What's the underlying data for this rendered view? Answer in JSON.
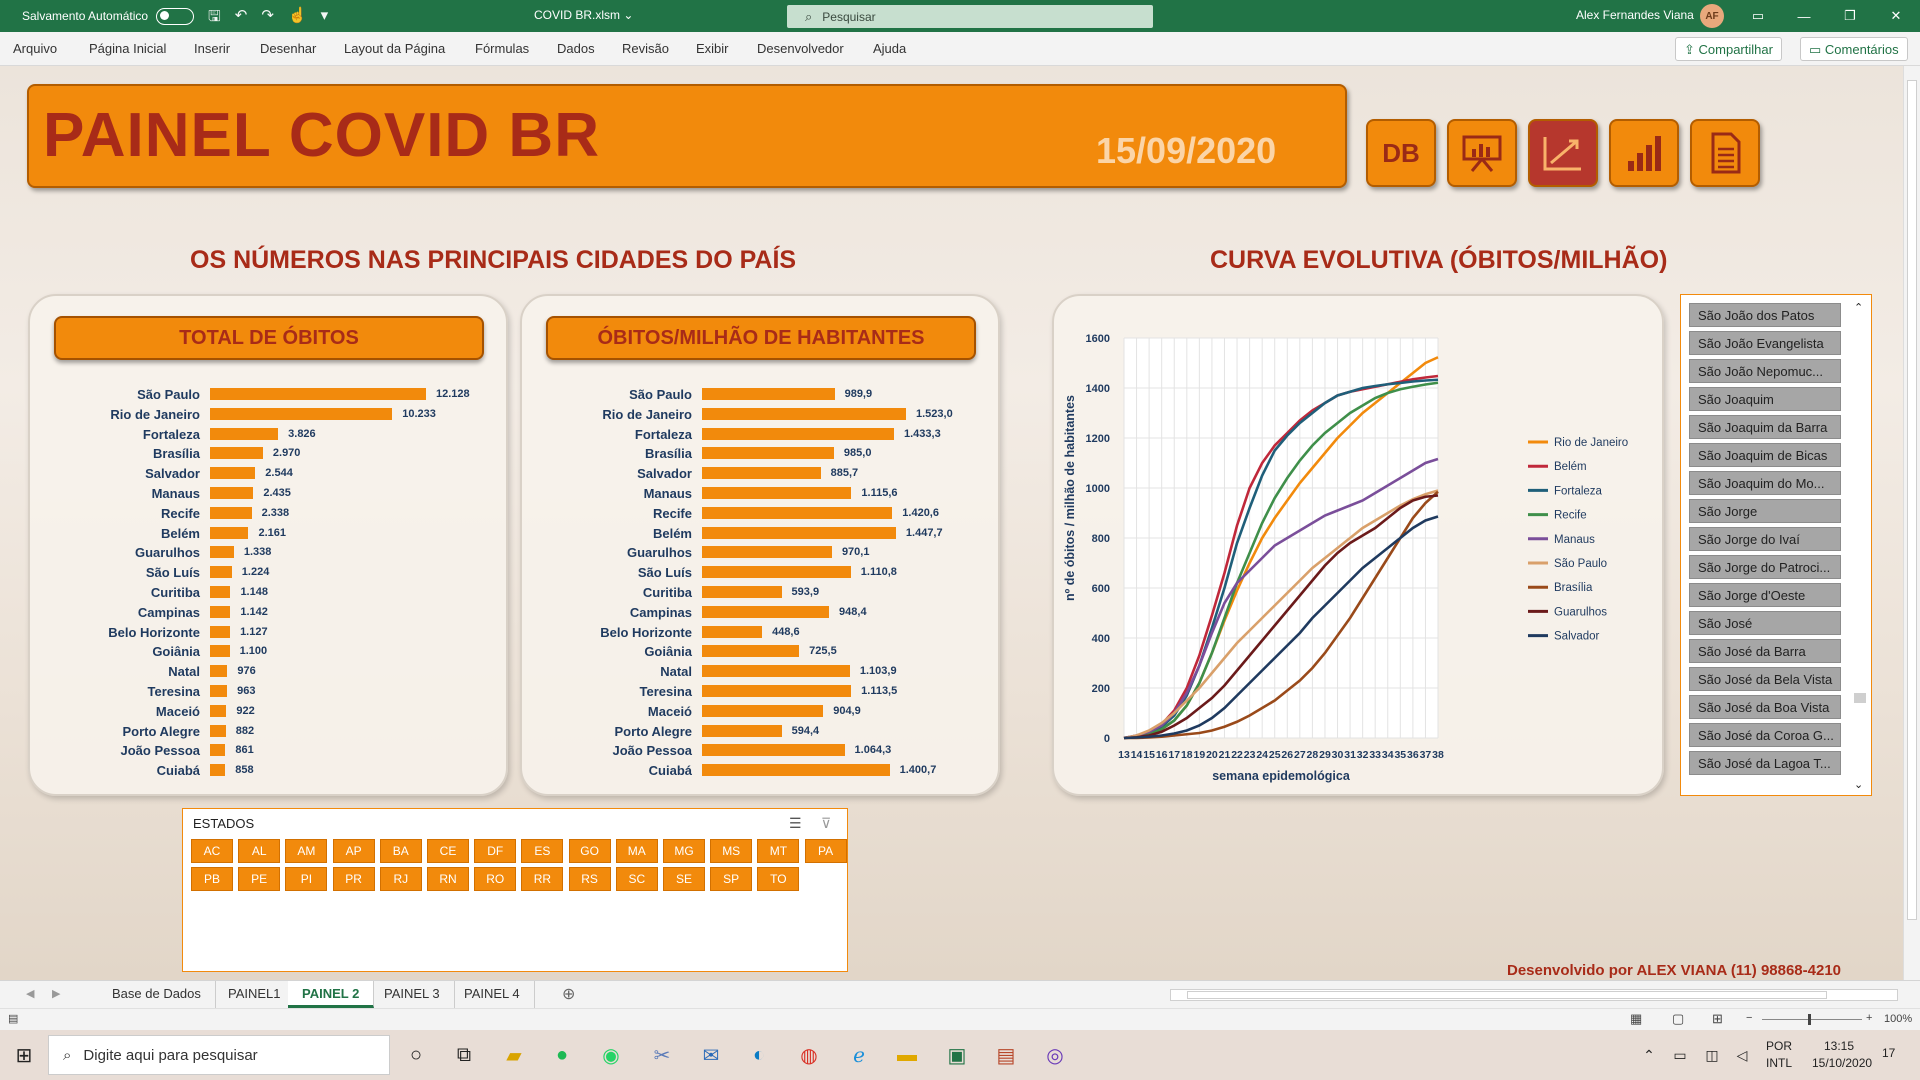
{
  "titlebar": {
    "autosave_label": "Salvamento Automático",
    "doc_title": "COVID BR.xlsm",
    "doc_caret": "⌄",
    "search_placeholder": "Pesquisar",
    "user_name": "Alex Fernandes Viana",
    "user_initials": "AF"
  },
  "menu": {
    "items": [
      "Arquivo",
      "Página Inicial",
      "Inserir",
      "Desenhar",
      "Layout da Página",
      "Fórmulas",
      "Dados",
      "Revisão",
      "Exibir",
      "Desenvolvedor",
      "Ajuda"
    ],
    "share": "Compartilhar",
    "comments": "Comentários"
  },
  "banner": {
    "title": "PAINEL COVID BR",
    "date": "15/09/2020",
    "nav_db": "DB"
  },
  "sections": {
    "left_title": "OS NÚMEROS NAS PRINCIPAIS CIDADES DO PAÍS",
    "right_title": "CURVA EVOLUTIVA (ÓBITOS/MILHÃO)"
  },
  "panels": {
    "total_title": "TOTAL DE ÓBITOS",
    "per_million_title": "ÓBITOS/MILHÃO DE HABITANTES"
  },
  "cities": [
    "São Paulo",
    "Rio de Janeiro",
    "Fortaleza",
    "Brasília",
    "Salvador",
    "Manaus",
    "Recife",
    "Belém",
    "Guarulhos",
    "São Luís",
    "Curitiba",
    "Campinas",
    "Belo Horizonte",
    "Goiânia",
    "Natal",
    "Teresina",
    "Maceió",
    "Porto Alegre",
    "João Pessoa",
    "Cuiabá"
  ],
  "total_obitos": {
    "values": [
      12128,
      10233,
      3826,
      2970,
      2544,
      2435,
      2338,
      2161,
      1338,
      1224,
      1148,
      1142,
      1127,
      1100,
      976,
      963,
      922,
      882,
      861,
      858
    ],
    "labels": [
      "12.128",
      "10.233",
      "3.826",
      "2.970",
      "2.544",
      "2.435",
      "2.338",
      "2.161",
      "1.338",
      "1.224",
      "1.148",
      "1.142",
      "1.127",
      "1.100",
      "976",
      "963",
      "922",
      "882",
      "861",
      "858"
    ]
  },
  "obitos_milhao": {
    "values": [
      989.9,
      1523.0,
      1433.3,
      985.0,
      885.7,
      1115.6,
      1420.6,
      1447.7,
      970.1,
      1110.8,
      593.9,
      948.4,
      448.6,
      725.5,
      1103.9,
      1113.5,
      904.9,
      594.4,
      1064.3,
      1400.7
    ],
    "labels": [
      "989,9",
      "1.523,0",
      "1.433,3",
      "985,0",
      "885,7",
      "1.115,6",
      "1.420,6",
      "1.447,7",
      "970,1",
      "1.110,8",
      "593,9",
      "948,4",
      "448,6",
      "725,5",
      "1.103,9",
      "1.113,5",
      "904,9",
      "594,4",
      "1.064,3",
      "1.400,7"
    ]
  },
  "chart_data": {
    "type": "line",
    "title": "",
    "xlabel": "semana epidemológica",
    "ylabel": "nº de óbitos / milhão de habitantes",
    "x": [
      13,
      14,
      15,
      16,
      17,
      18,
      19,
      20,
      21,
      22,
      23,
      24,
      25,
      26,
      27,
      28,
      29,
      30,
      31,
      32,
      33,
      34,
      35,
      36,
      37,
      38
    ],
    "ylim": [
      0,
      1600
    ],
    "yticks": [
      0,
      200,
      400,
      600,
      800,
      1000,
      1200,
      1400,
      1600
    ],
    "grid": true,
    "legend_position": "right",
    "series": [
      {
        "name": "Rio de Janeiro",
        "color": "#f28a0c",
        "values": [
          0,
          5,
          15,
          35,
          70,
          130,
          220,
          340,
          470,
          590,
          700,
          800,
          880,
          950,
          1020,
          1080,
          1140,
          1200,
          1250,
          1300,
          1340,
          1380,
          1420,
          1460,
          1500,
          1523
        ]
      },
      {
        "name": "Belém",
        "color": "#c0283a",
        "values": [
          0,
          10,
          25,
          55,
          110,
          200,
          330,
          490,
          660,
          850,
          1000,
          1100,
          1170,
          1220,
          1270,
          1310,
          1340,
          1370,
          1385,
          1395,
          1405,
          1415,
          1425,
          1435,
          1442,
          1448
        ]
      },
      {
        "name": "Fortaleza",
        "color": "#1f5f7a",
        "values": [
          0,
          8,
          20,
          45,
          90,
          170,
          290,
          440,
          600,
          780,
          920,
          1050,
          1150,
          1210,
          1260,
          1300,
          1340,
          1370,
          1385,
          1400,
          1408,
          1415,
          1420,
          1426,
          1430,
          1433
        ]
      },
      {
        "name": "Recife",
        "color": "#3f8f4a",
        "values": [
          0,
          5,
          15,
          35,
          70,
          130,
          220,
          340,
          480,
          620,
          740,
          860,
          960,
          1040,
          1110,
          1170,
          1220,
          1260,
          1300,
          1330,
          1360,
          1380,
          1395,
          1405,
          1414,
          1421
        ]
      },
      {
        "name": "Manaus",
        "color": "#7a4e9a",
        "values": [
          0,
          10,
          25,
          50,
          100,
          180,
          290,
          420,
          540,
          620,
          670,
          720,
          770,
          800,
          830,
          860,
          890,
          910,
          930,
          950,
          980,
          1010,
          1040,
          1070,
          1100,
          1116
        ]
      },
      {
        "name": "São Paulo",
        "color": "#d9a06a",
        "values": [
          0,
          10,
          30,
          60,
          100,
          150,
          200,
          260,
          320,
          380,
          430,
          480,
          530,
          580,
          630,
          680,
          720,
          760,
          800,
          840,
          870,
          900,
          930,
          955,
          975,
          990
        ]
      },
      {
        "name": "Brasília",
        "color": "#9a4a1a",
        "values": [
          0,
          0,
          2,
          5,
          10,
          15,
          20,
          30,
          45,
          65,
          90,
          120,
          150,
          190,
          230,
          280,
          340,
          410,
          480,
          560,
          640,
          720,
          800,
          880,
          940,
          985
        ]
      },
      {
        "name": "Guarulhos",
        "color": "#6b1a1a",
        "values": [
          0,
          3,
          10,
          25,
          50,
          80,
          120,
          160,
          210,
          270,
          330,
          390,
          450,
          510,
          570,
          630,
          690,
          740,
          780,
          810,
          840,
          880,
          920,
          950,
          965,
          970
        ]
      },
      {
        "name": "Salvador",
        "color": "#1f3a5f",
        "values": [
          0,
          2,
          5,
          10,
          18,
          30,
          50,
          80,
          120,
          170,
          220,
          270,
          320,
          370,
          420,
          480,
          530,
          580,
          630,
          680,
          720,
          760,
          800,
          840,
          870,
          886
        ]
      }
    ]
  },
  "slicer_cities": {
    "items": [
      "São João dos Patos",
      "São João Evangelista",
      "São João Nepomuc...",
      "São Joaquim",
      "São Joaquim da Barra",
      "São Joaquim de Bicas",
      "São Joaquim do Mo...",
      "São Jorge",
      "São Jorge do Ivaí",
      "São Jorge do Patroci...",
      "São Jorge d'Oeste",
      "São José",
      "São José da Barra",
      "São José da Bela Vista",
      "São José da Boa Vista",
      "São José da Coroa G...",
      "São José da Lagoa T..."
    ]
  },
  "estados": {
    "title": "ESTADOS",
    "row1": [
      "AC",
      "AL",
      "AM",
      "AP",
      "BA",
      "CE",
      "DF",
      "ES",
      "GO",
      "MA",
      "MG",
      "MS",
      "MT",
      "PA"
    ],
    "row2": [
      "PB",
      "PE",
      "PI",
      "PR",
      "RJ",
      "RN",
      "RO",
      "RR",
      "RS",
      "SC",
      "SE",
      "SP",
      "TO"
    ]
  },
  "credit": "Desenvolvido por ALEX VIANA (11) 98868-4210",
  "sheet_tabs": [
    "Base de Dados",
    "PAINEL1",
    "PAINEL 2",
    "PAINEL 3",
    "PAINEL 4"
  ],
  "active_tab": "PAINEL 2",
  "statusbar": {
    "zoom": "100%"
  },
  "taskbar": {
    "search_placeholder": "Digite aqui para pesquisar",
    "lang1": "POR",
    "lang2": "INTL",
    "time": "13:15",
    "date": "15/10/2020",
    "notif": "17"
  }
}
